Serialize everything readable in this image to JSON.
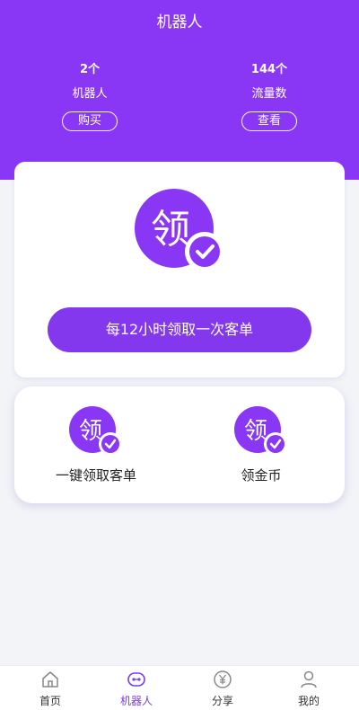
{
  "header": {
    "title": "机器人",
    "stats": [
      {
        "value": "2个",
        "label": "机器人",
        "button": "购买"
      },
      {
        "value": "144个",
        "label": "流量数",
        "button": "查看"
      }
    ]
  },
  "main_card": {
    "icon_char": "领",
    "cta_label": "每12小时领取一次客单"
  },
  "actions": [
    {
      "icon_char": "领",
      "label": "一键领取客单"
    },
    {
      "icon_char": "领",
      "label": "领金币"
    }
  ],
  "tabs": [
    {
      "label": "首页",
      "icon": "home-icon"
    },
    {
      "label": "机器人",
      "icon": "robot-icon"
    },
    {
      "label": "分享",
      "icon": "yen-icon"
    },
    {
      "label": "我的",
      "icon": "user-icon"
    }
  ],
  "active_tab": 1,
  "colors": {
    "accent": "#8a37f5",
    "button": "#8338ee",
    "tab_active": "#7b3aed"
  }
}
